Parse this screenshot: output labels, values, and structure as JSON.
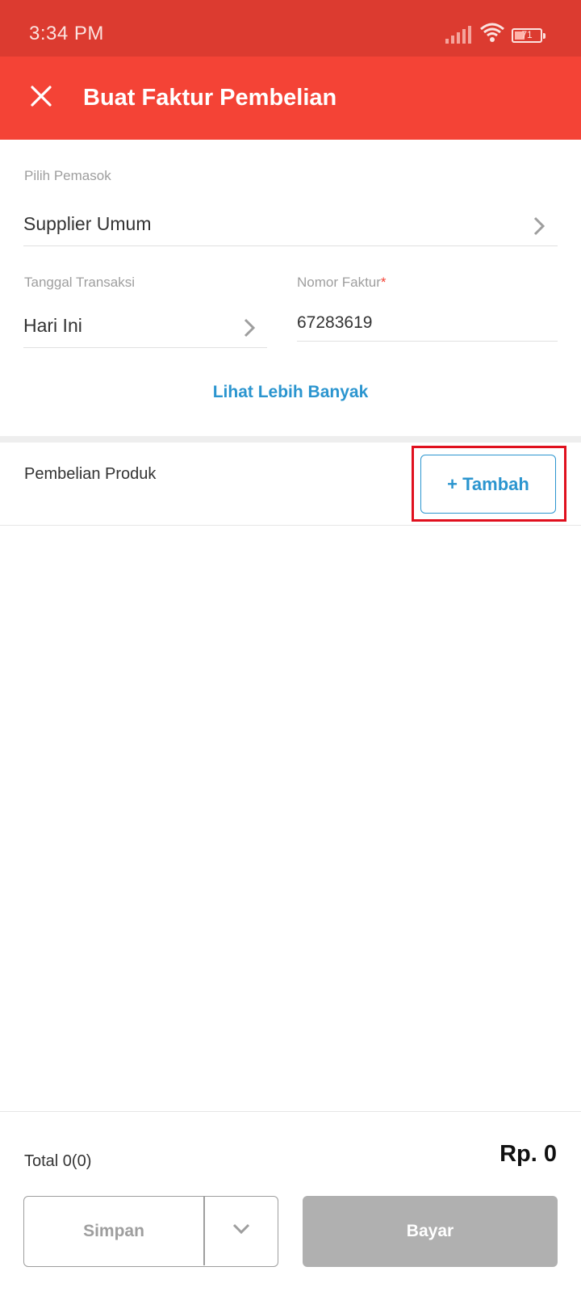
{
  "status_bar": {
    "time": "3:34 PM",
    "battery": "71"
  },
  "app_bar": {
    "title": "Buat Faktur Pembelian",
    "accent": "#f44336"
  },
  "form": {
    "supplier_label": "Pilih Pemasok",
    "supplier_value": "Supplier Umum",
    "date_label": "Tanggal Transaksi",
    "date_value": "Hari Ini",
    "invoice_label": "Nomor Faktur",
    "invoice_required": "*",
    "invoice_value": "67283619",
    "more_link": "Lihat Lebih Banyak"
  },
  "products": {
    "title": "Pembelian Produk",
    "add_label": "+ Tambah"
  },
  "footer": {
    "total_label": "Total 0(0)",
    "total_value": "Rp. 0",
    "save_label": "Simpan",
    "pay_label": "Bayar"
  }
}
